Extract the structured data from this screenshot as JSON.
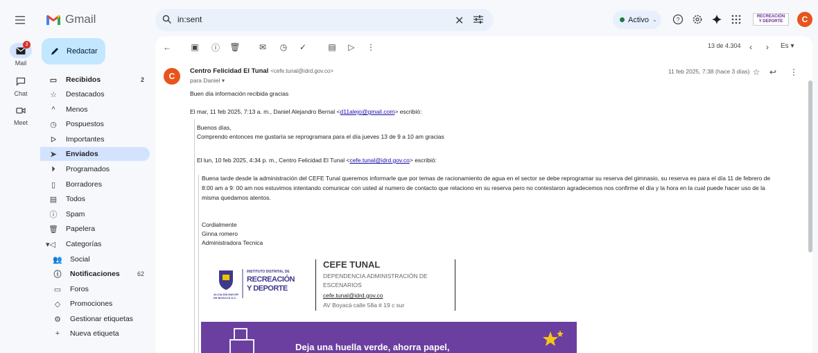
{
  "app": {
    "name": "Gmail"
  },
  "search": {
    "query": "in:sent"
  },
  "status": {
    "label": "Activo"
  },
  "brand_mini": {
    "line1": "RECREACIÓN",
    "line2": "Y DEPORTE"
  },
  "account": {
    "initial": "C"
  },
  "rail": [
    {
      "label": "Mail",
      "badge": "3"
    },
    {
      "label": "Chat"
    },
    {
      "label": "Meet"
    }
  ],
  "compose": {
    "label": "Redactar"
  },
  "nav": [
    {
      "label": "Recibidos",
      "count": "2"
    },
    {
      "label": "Destacados"
    },
    {
      "label": "Menos"
    },
    {
      "label": "Pospuestos"
    },
    {
      "label": "Importantes"
    },
    {
      "label": "Enviados"
    },
    {
      "label": "Programados"
    },
    {
      "label": "Borradores"
    },
    {
      "label": "Todos"
    },
    {
      "label": "Spam"
    },
    {
      "label": "Papelera"
    },
    {
      "label": "Categorías"
    },
    {
      "label": "Social"
    },
    {
      "label": "Notificaciones",
      "count": "62"
    },
    {
      "label": "Foros"
    },
    {
      "label": "Promociones"
    },
    {
      "label": "Gestionar etiquetas"
    },
    {
      "label": "Nueva etiqueta"
    }
  ],
  "toolbar": {
    "pager": "13 de 4.304",
    "lang": "Es"
  },
  "email": {
    "sender_initial": "C",
    "sender_name": "Centro Felicidad El Tunal",
    "sender_addr": "<cefe.tunal@idrd.gov.co>",
    "to": "para Daniel",
    "date": "11 feb 2025, 7:38 (hace 3 días)",
    "reply": "Buen día información recibida gracias",
    "quote1_header_pre": "El mar, 11 feb 2025, 7:13 a. m., Daniel Alejandro Bernal <",
    "quote1_header_link": "d11alejo@gmail.com",
    "quote1_header_post": "> escribió:",
    "quote1_line1": "Buenos días,",
    "quote1_line2": "Comprendo entonces me gustaría se reprogramara para el día jueves 13 de 9 a 10 am gracias",
    "quote2_header_pre": "El lun, 10 feb 2025, 4:34 p. m., Centro Felicidad El Tunal <",
    "quote2_header_link": "cefe.tunal@idrd.gov.co",
    "quote2_header_post": "> escribió:",
    "quote2_body1": "Buena tarde desde la administración del CEFE Tunal queremos informarle que por temas de racionamiento de agua en el sector se debe reprogramar su reserva del gimnasio, su reserva es para el día 11 de febrero de",
    "quote2_body2": "8:00 am a 9: 00 am nos estuvimos intentando comunicar con usted al numero de contacto que relaciono en su reserva pero no contestaron agradecemos nos confirme el día y la hora en la cual puede hacer uso de la",
    "quote2_body3": "misma quedamos atentos.",
    "closing": "Cordialmente",
    "signer": "Ginna romero",
    "signer_title": "Administradora Tecnica"
  },
  "signature": {
    "logo_line1": "INSTITUTO DISTRITAL DE",
    "logo_line2": "RECREACIÓN",
    "logo_line3": "Y DEPORTE",
    "logo_small": "ALCALDÍA MAYOR DE BOGOTÁ D.C.",
    "title": "CEFE TUNAL",
    "dep1": "DEPENDENCIA ADMINISTRACIÓN DE",
    "dep2": "ESCENARIOS",
    "email": "cefe.tunal@idrd.gov.co",
    "address": "AV Boyacá calle 58a # 19 c sur",
    "banner": "Deja una huella verde, ahorra papel,"
  },
  "colors": {
    "accent": "#d3e3fd",
    "brand_purple": "#6b3fa0",
    "avatar": "#e8541c"
  }
}
